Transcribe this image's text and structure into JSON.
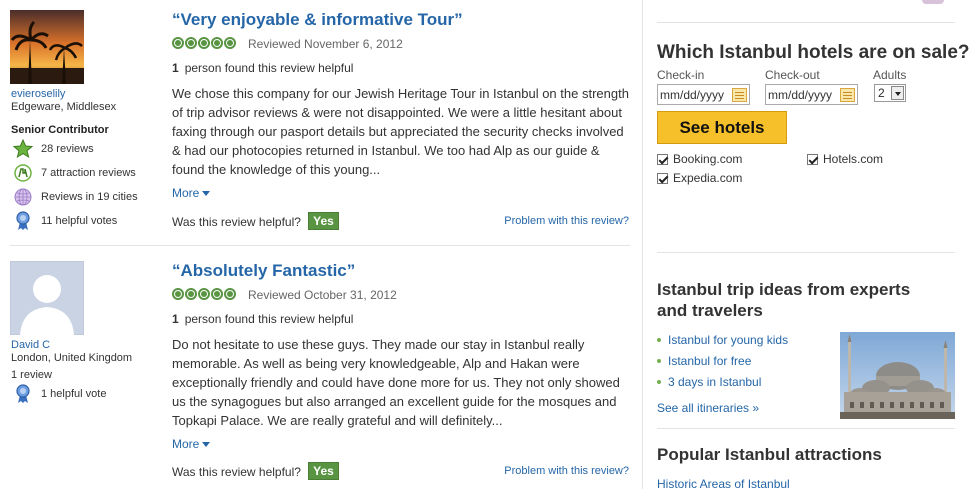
{
  "reviews": [
    {
      "username": "evieroselily",
      "location": "Edgeware, Middlesex",
      "level": "Senior Contributor",
      "badges": [
        {
          "icon": "star-icon",
          "text": "28 reviews"
        },
        {
          "icon": "attraction-icon",
          "text": "7 attraction reviews"
        },
        {
          "icon": "globe-icon",
          "text": "Reviews in 19 cities"
        },
        {
          "icon": "helpful-ribbon-icon",
          "text": "11 helpful votes"
        }
      ],
      "title": "“Very enjoyable & informative Tour”",
      "rating_bubbles": 5,
      "reviewed": "Reviewed November 6, 2012",
      "helpful_count": "1",
      "helpful_text": "person found this review helpful",
      "body": "We chose this company for our Jewish Heritage Tour in Istanbul on the strength of trip advisor reviews & were not disappointed. We were a little hesitant about faxing through our pasport details but appreciated the security checks involved & had our photocopies returned in Istanbul. We too had Alp as our guide & found the knowledge of this young...",
      "more": "More",
      "was_helpful": "Was this review helpful?",
      "yes": "Yes",
      "problem": "Problem with this review?"
    },
    {
      "username": "David C",
      "location": "London, United Kingdom",
      "level": "1 review",
      "badges": [
        {
          "icon": "helpful-ribbon-icon",
          "text": "1 helpful vote"
        }
      ],
      "title": "“Absolutely Fantastic”",
      "rating_bubbles": 5,
      "reviewed": "Reviewed October 31, 2012",
      "helpful_count": "1",
      "helpful_text": "person found this review helpful",
      "body": "Do not hesitate to use these guys. They made our stay in Istanbul really memorable. As well as being very knowledgeable, Alp and Hakan were exceptionally friendly and could have done more for us. They not only showed us the synagogues but also arranged an excellent guide for the mosques and Topkapi Palace. We are really grateful and will definitely...",
      "more": "More",
      "was_helpful": "Was this review helpful?",
      "yes": "Yes",
      "problem": "Problem with this review?"
    }
  ],
  "hotels": {
    "title": "Which Istanbul hotels are on sale?",
    "checkin_label": "Check-in",
    "checkout_label": "Check-out",
    "adults_label": "Adults",
    "checkin_value": "mm/dd/yyyy",
    "checkout_value": "mm/dd/yyyy",
    "adults_value": "2",
    "button": "See hotels",
    "providers": [
      {
        "label": "Booking.com",
        "checked": true
      },
      {
        "label": "Hotels.com",
        "checked": true
      },
      {
        "label": "Expedia.com",
        "checked": true
      }
    ]
  },
  "trips": {
    "title": "Istanbul trip ideas from experts and travelers",
    "items": [
      "Istanbul for young kids",
      "Istanbul for free",
      "3 days in Istanbul"
    ],
    "see_all": "See all itineraries »"
  },
  "attractions": {
    "title": "Popular Istanbul attractions",
    "first_link": "Historic Areas of Istanbul"
  },
  "colors": {
    "link": "#2566a8",
    "bubble_green": "#589442",
    "yes_button": "#589442",
    "see_hotels_yellow": "#f5c02a"
  }
}
